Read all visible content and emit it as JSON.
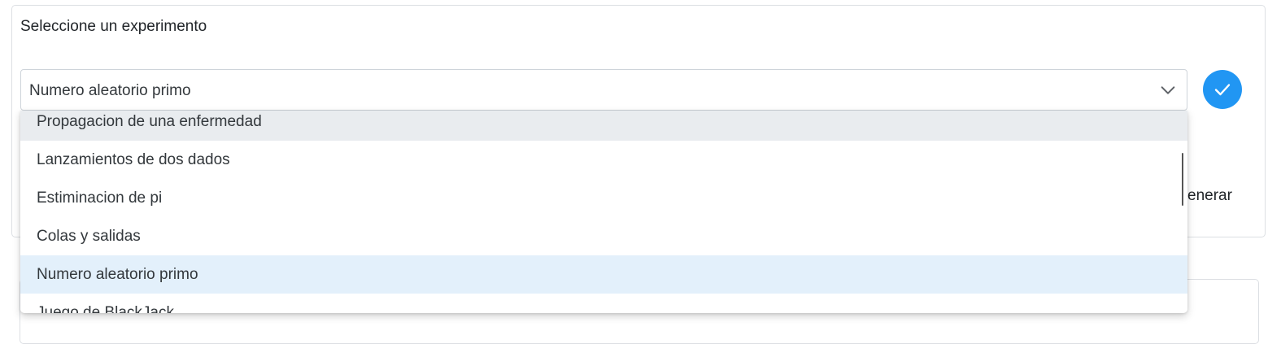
{
  "card": {
    "title": "Seleccione un experimento"
  },
  "select": {
    "value": "Numero aleatorio primo"
  },
  "icons": {
    "chevron": "chevron-down-icon",
    "confirm": "check-icon"
  },
  "colors": {
    "accent": "#2196f3",
    "hover_row": "#e9ecef",
    "selected_row": "#e3f0fb"
  },
  "generate_button": {
    "label_partial": "enerar"
  },
  "dropdown": {
    "options": [
      "Propagacion de una enfermedad",
      "Lanzamientos de dos dados",
      "Estiminacion de pi",
      "Colas y salidas",
      "Numero aleatorio primo",
      "Juego de BlackJack"
    ],
    "hovered_index": 0,
    "selected_index": 4
  }
}
